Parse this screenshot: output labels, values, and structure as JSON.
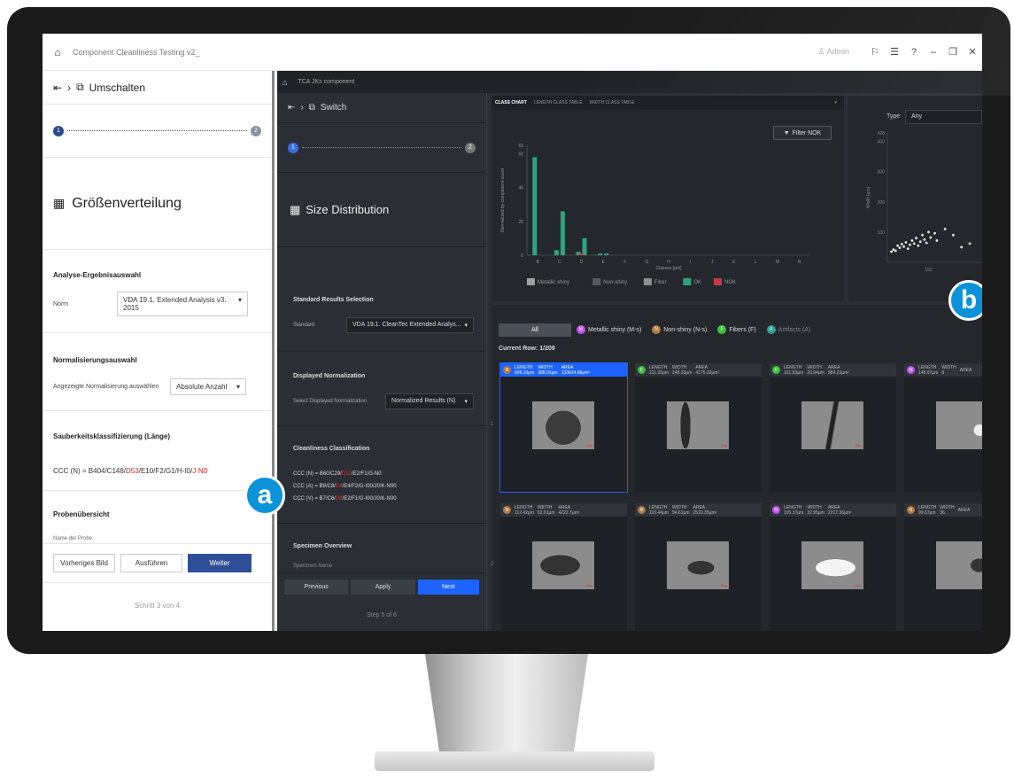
{
  "left_app": {
    "title": "Component Cleanliness Testing v2_",
    "user": "Admin",
    "breadcrumb_label": "Umschalten",
    "step_start": "1",
    "step_end": "2",
    "page_title": "Größenverteilung",
    "std_section": "Analyse-Ergebnisauswahl",
    "std_label": "Norm",
    "std_value": "VDA 19.1. Extended Analysis v3. 2015",
    "norm_section": "Normalisierungsauswahl",
    "norm_label": "Angezeigte Normalisierung auswählen",
    "norm_value": "Absolute Anzahl",
    "class_section": "Sauberkeitsklassifizierung (Länge)",
    "ccc_a": "CCC (N) = B404/C148/",
    "ccc_b": "D53",
    "ccc_c": "/E10/F2/G1/H-I0/",
    "ccc_d": "J-N0",
    "spec_section": "Probenübersicht",
    "spec_name": "Name der Probe",
    "prev_button": "Vorheriges Bild",
    "run_button": "Ausführen",
    "next_button": "Weiter",
    "step_footer": "Schritt 3 von 4"
  },
  "right_app": {
    "title": "TCA JKs component",
    "breadcrumb_label": "Switch",
    "step_start": "1",
    "step_end": "2",
    "page_title": "Size Distribution",
    "std_section": "Standard Results Selection",
    "std_label": "Standard",
    "std_value": "VDA 19.1. CleanTec Extended Analys...",
    "norm_section": "Displayed Normalization",
    "norm_label": "Select Displayed Normalization",
    "norm_value": "Normalized Results (N)",
    "class_section": "Cleanliness Classification",
    "ccc_n": "CCC (N) = B60/C29/",
    "ccc_n_red": "D12",
    "ccc_n_end": "/E2/F1/G-N0",
    "ccc_a": "CCC (A) = B9/C8/",
    "ccc_a_red": "D4",
    "ccc_a_end": "/E4/F2/G-I00/J0/K-N00",
    "ccc_v": "CCC (V) = B7/C6/",
    "ccc_v_red": "D3",
    "ccc_v_end": "/E2/F1/G-I00/J0/K-N00",
    "spec_section": "Specimen Overview",
    "spec_name": "Specimen Name",
    "prev_button": "Previous",
    "apply_button": "Apply",
    "next_button": "Next",
    "step_footer": "Step 5 of 6"
  },
  "chart_tabs": [
    "CLASS CHART",
    "LENGTH CLASS TABLE",
    "WIDTH CLASS TABLE"
  ],
  "filter_button": "Filter NOK",
  "chart_data": [
    {
      "type": "bar",
      "categories": [
        "B",
        "C",
        "D",
        "E",
        "F",
        "G",
        "H",
        "I",
        "J",
        "K",
        "L",
        "M",
        "N"
      ],
      "series": [
        {
          "name": "Metallic shiny",
          "values": [
            0,
            0,
            0,
            0,
            0,
            0,
            0,
            0,
            0,
            0,
            0,
            0,
            0
          ]
        },
        {
          "name": "Non-shiny",
          "values": [
            0,
            0,
            0,
            0,
            0,
            0,
            0,
            0,
            0,
            0,
            0,
            0,
            0
          ]
        },
        {
          "name": "Fiber",
          "values": [
            0,
            0,
            0,
            0,
            0,
            0,
            0,
            0,
            0,
            0,
            0,
            0,
            0
          ]
        },
        {
          "name": "OK",
          "values": [
            58,
            3,
            2,
            1,
            0,
            0,
            0,
            0,
            0,
            0,
            0,
            0,
            0
          ]
        },
        {
          "name": "NOK",
          "values": [
            0,
            26,
            10,
            1,
            0,
            0,
            0,
            0,
            0,
            0,
            0,
            0,
            0
          ]
        }
      ],
      "xlabel": "Classes [µm]",
      "ylabel": "Normalized by component count",
      "yticks": [
        0,
        20,
        40,
        60
      ],
      "ytop_label": "65",
      "ylim": [
        0,
        65
      ],
      "legend_position": "bottom",
      "colors": [
        "#a0a0a0",
        "#555a60",
        "#8f8f8f",
        "#2fa37f",
        "#c73a4a"
      ]
    },
    {
      "type": "scatter",
      "ylabel": "Width [µm]",
      "yticks": [
        100,
        200,
        300,
        400
      ],
      "ytop_label": "428",
      "xtick": "100",
      "ylim": [
        0,
        428
      ],
      "xlim": [
        0,
        230
      ],
      "points": [
        [
          10,
          35
        ],
        [
          15,
          42
        ],
        [
          20,
          38
        ],
        [
          25,
          55
        ],
        [
          30,
          48
        ],
        [
          35,
          60
        ],
        [
          40,
          52
        ],
        [
          45,
          66
        ],
        [
          50,
          45
        ],
        [
          55,
          58
        ],
        [
          60,
          72
        ],
        [
          65,
          62
        ],
        [
          70,
          80
        ],
        [
          75,
          55
        ],
        [
          80,
          68
        ],
        [
          85,
          90
        ],
        [
          90,
          75
        ],
        [
          95,
          64
        ],
        [
          100,
          100
        ],
        [
          105,
          82
        ],
        [
          115,
          96
        ],
        [
          120,
          72
        ],
        [
          140,
          110
        ],
        [
          160,
          90
        ],
        [
          180,
          50
        ],
        [
          200,
          62
        ]
      ]
    }
  ],
  "scatter_type_label": "Type",
  "scatter_type_value": "Any",
  "filters": [
    "All",
    "Metallic shiny (M-s)",
    "Non-shiny (N-s)",
    "Fibers (F)",
    "Artifacts (A)"
  ],
  "filter_letters": [
    "M",
    "N",
    "F",
    "A"
  ],
  "filter_colors": [
    "#c050f0",
    "#b07a40",
    "#40c040",
    "#2aa090"
  ],
  "current_row": "Current Row: 1/209",
  "row_labels": [
    "1",
    "2"
  ],
  "cards": [
    {
      "type": "N",
      "length": "609.10µm",
      "width": "388.55µm",
      "area": "133624.68µm²",
      "color": "#b07a40",
      "selected": true
    },
    {
      "type": "F",
      "length": "211.30µm",
      "width": "148.33µm",
      "area": "4175.32µm²",
      "color": "#40c040"
    },
    {
      "type": "F",
      "length": "161.63µm",
      "width": "23.94µm",
      "area": "984.23µm²",
      "color": "#40c040"
    },
    {
      "type": "M",
      "length": "148.97µm",
      "width": "8",
      "area": "",
      "color": "#c050f0"
    },
    {
      "type": "N",
      "length": "112.42µm",
      "width": "62.61µm",
      "area": "4222.7µm²",
      "color": "#b07a40"
    },
    {
      "type": "N",
      "length": "110.44µm",
      "width": "54.61µm",
      "area": "2510.35µm²",
      "color": "#b07a40"
    },
    {
      "type": "M",
      "length": "105.17µm",
      "width": "32.95µm",
      "area": "2217.36µm²",
      "color": "#c050f0"
    },
    {
      "type": "N",
      "length": "99.67µm",
      "width": "36.",
      "area": "",
      "color": "#b07a40"
    }
  ],
  "card_labels": {
    "length": "LENGTH",
    "width": "WIDTH",
    "area": "AREA",
    "scale": "100µm",
    "scale_short": "20µ"
  },
  "badges": [
    "a",
    "b"
  ]
}
